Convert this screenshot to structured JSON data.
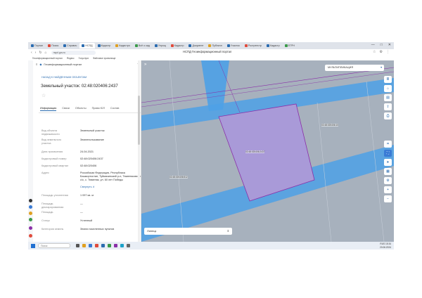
{
  "browser": {
    "tabs": [
      {
        "label": "Портал",
        "color": "#2b6cb0"
      },
      {
        "label": "Поиск",
        "color": "#e04b3c"
      },
      {
        "label": "Справоч",
        "color": "#2b6cb0"
      },
      {
        "label": "НСПД",
        "color": "#2b6cb0",
        "active": true
      },
      {
        "label": "Кадастр",
        "color": "#2b6cb0"
      },
      {
        "label": "Кадастро",
        "color": "#e0a020"
      },
      {
        "label": "Всё о кад",
        "color": "#3a9a4a"
      },
      {
        "label": "Упрощ",
        "color": "#2b6cb0"
      },
      {
        "label": "Кадастр",
        "color": "#e04b3c"
      },
      {
        "label": "Документ",
        "color": "#2b6cb0"
      },
      {
        "label": "Публичн",
        "color": "#e0a020"
      },
      {
        "label": "Участок",
        "color": "#2b6cb0"
      },
      {
        "label": "Ростреестр",
        "color": "#e04b3c"
      },
      {
        "label": "Кадастр",
        "color": "#2b6cb0"
      },
      {
        "label": "ЕГРН",
        "color": "#3a9a4a"
      }
    ],
    "url": "nspd.gov.ru",
    "page_title": "НСПД Геоинформационный портал",
    "bookmarks": [
      "Геоинформационный портал",
      "Яндекс",
      "Госуслуги",
      "Файловое хранилище"
    ],
    "window_controls": [
      "—",
      "□",
      "✕"
    ]
  },
  "panel": {
    "header": "Геоинформационный портал",
    "back": "НАЗАД К НАЙДЕННЫМ ОБЪЕКТАМ",
    "title": "Земельный участок: 02:48:020406:2437",
    "tabs": [
      "Информация",
      "Связи",
      "Объекты",
      "Права ЮЛ",
      "Состав"
    ],
    "rows": [
      {
        "key": "Вид объекта недвижимости",
        "value": "Земельный участок"
      },
      {
        "key": "Вид земельного участка",
        "value": "Землепользование"
      },
      {
        "key": "Дата присвоения",
        "value": "24.04.2021"
      },
      {
        "key": "Кадастровый номер",
        "value": "02:48:020406:2437"
      },
      {
        "key": "Кадастровый квартал",
        "value": "02:48:020406"
      },
      {
        "key": "Адрес",
        "value": "Российская Федерация, Республика Башкортостан, Туймазинский р-н, Тюменяковский с/с, с. Тюменяк, ул. 60 лет Победы"
      },
      {
        "key": "",
        "value": "Свернуть ∧",
        "link": true
      },
      {
        "key": "Площадь уточненная",
        "value": "1 097 кв. м"
      },
      {
        "key": "Площадь декларированная",
        "value": "—"
      },
      {
        "key": "Площадь",
        "value": "—"
      },
      {
        "key": "Статус",
        "value": "Учтенный"
      },
      {
        "key": "Категория земель",
        "value": "Земли населенных пунктов"
      }
    ]
  },
  "map": {
    "selector": "МУЛЬТИПЛИКАЦИЯ",
    "layer": "Липецк",
    "labels": [
      "02:48:020406:2437",
      "02:48:020406:512",
      "02:48:020406:10"
    ],
    "tools": [
      "layers-icon",
      "home-icon",
      "legend-icon",
      "print-icon",
      "share-icon",
      "printer-icon",
      "measure-icon",
      "locate-icon",
      "fullscreen-icon",
      "settings-icon",
      "zoom-in-icon",
      "zoom-out-icon"
    ],
    "colors": {
      "parcel_fill": "#a99ad8",
      "parcel_stroke": "#8a2fa8",
      "road": "#4ea1e6",
      "ground": "#a7b1bd"
    }
  },
  "taskbar": {
    "search": "Поиск",
    "time": "15:34",
    "date": "20.06.2024",
    "lang": "RUS"
  }
}
